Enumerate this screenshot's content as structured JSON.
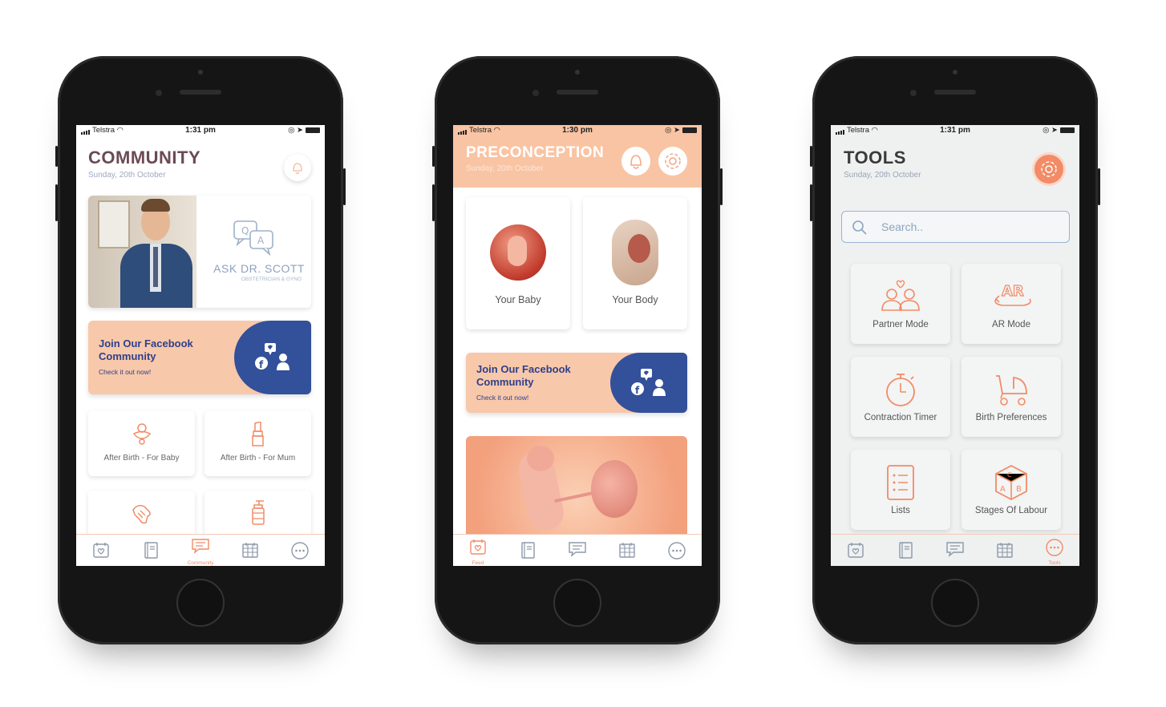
{
  "status": {
    "carrier": "Telstra"
  },
  "phone1": {
    "time": "1:31 pm",
    "title": "COMMUNITY",
    "date": "Sunday, 20th October",
    "ask_title": "ASK DR. SCOTT",
    "ask_sub": "OBSTETRICIAN & GYNO",
    "fb_title": "Join Our Facebook Community",
    "fb_sub": "Check it out now!",
    "tiles": [
      "After Birth - For Baby",
      "After Birth - For Mum"
    ],
    "active_tab_label": "Community"
  },
  "phone2": {
    "time": "1:30 pm",
    "title": "PRECONCEPTION",
    "date": "Sunday, 20th October",
    "cards": [
      "Your Baby",
      "Your Body"
    ],
    "fb_title": "Join Our Facebook Community",
    "fb_sub": "Check it out now!",
    "active_tab_label": "Feed"
  },
  "phone3": {
    "time": "1:31 pm",
    "title": "TOOLS",
    "date": "Sunday, 20th October",
    "search_placeholder": "Search..",
    "tools": [
      "Partner Mode",
      "AR Mode",
      "Contraction Timer",
      "Birth Preferences",
      "Lists",
      "Stages Of Labour"
    ],
    "active_tab_label": "Tools"
  },
  "colors": {
    "accent": "#f28b66",
    "peach": "#f9c4a3",
    "navy": "#33509a",
    "title_dark": "#6b4a55",
    "tool_title": "#3a3a3a"
  }
}
